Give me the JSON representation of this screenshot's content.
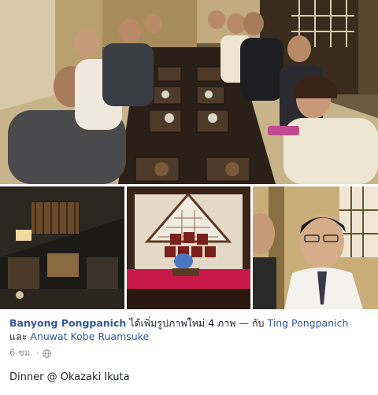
{
  "post": {
    "author": "Banyong Pongpanich",
    "action": " ได้เพิ่มรูปภาพใหม่ 4 ภาพ — กับ ",
    "tagged_1": "Ting Pongpanich",
    "conjunction": "และ ",
    "tagged_2": "Anuwat Kobe Ruamsuke",
    "timestamp": "6 ชม.",
    "separator": "·",
    "privacy_icon": "globe-icon",
    "text": "Dinner @ Okazaki Ikuta"
  },
  "photos": {
    "count": 4,
    "main": "group-dinner-photo",
    "thumbs": [
      "kyoto-street-photo",
      "tokonoma-alcove-photo",
      "two-men-photo"
    ]
  },
  "colors": {
    "link": "#365899",
    "text": "#1d2129",
    "meta": "#90949c"
  }
}
